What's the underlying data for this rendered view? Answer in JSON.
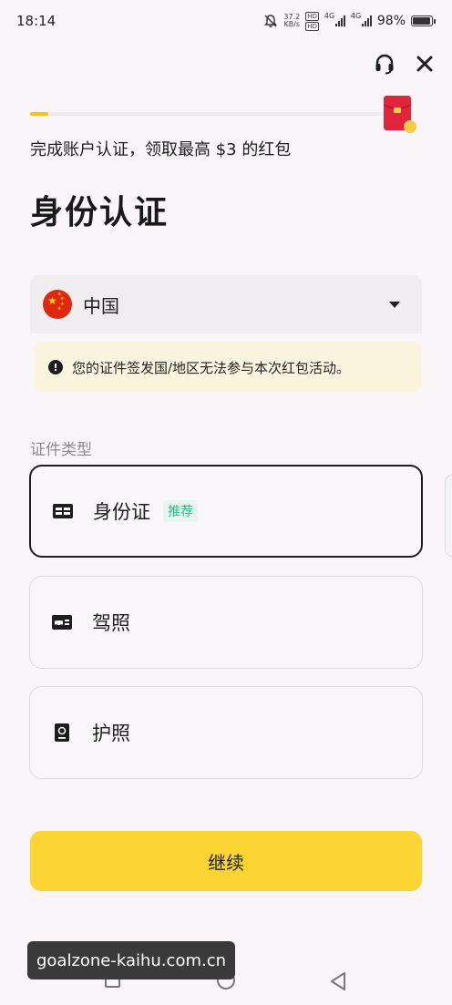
{
  "status_bar": {
    "time": "18:14",
    "net_speed_value": "37.2",
    "net_speed_unit": "KB/s",
    "hd1": "HD",
    "hd2": "HD",
    "sim1_network": "4G",
    "sim2_network": "4G",
    "battery": "98%"
  },
  "header": {
    "support_icon": "headset-icon",
    "close_icon": "close-icon",
    "reward_icon": "red-packet-icon"
  },
  "progress": {
    "fraction": 0.05,
    "color": "#f0c419"
  },
  "promo_text": "完成账户认证，领取最高 $3 的红包",
  "page_title": "身份认证",
  "country": {
    "flag_icon": "china-flag-icon",
    "selected": "中国"
  },
  "notice": {
    "icon": "exclamation-icon",
    "text": "您的证件签发国/地区无法参与本次红包活动。"
  },
  "doc_type": {
    "label": "证件类型",
    "options": [
      {
        "label": "身份证",
        "tag": "推荐",
        "icon": "id-card-icon",
        "selected": true
      },
      {
        "label": "驾照",
        "icon": "driver-license-icon",
        "selected": false
      },
      {
        "label": "护照",
        "icon": "passport-icon",
        "selected": false
      }
    ]
  },
  "continue_label": "继续",
  "watermark": "goalzone-kaihu.com.cn",
  "colors": {
    "accent": "#fcd535",
    "tag_green": "#2dbd85",
    "notice_bg": "#fbf5df"
  }
}
